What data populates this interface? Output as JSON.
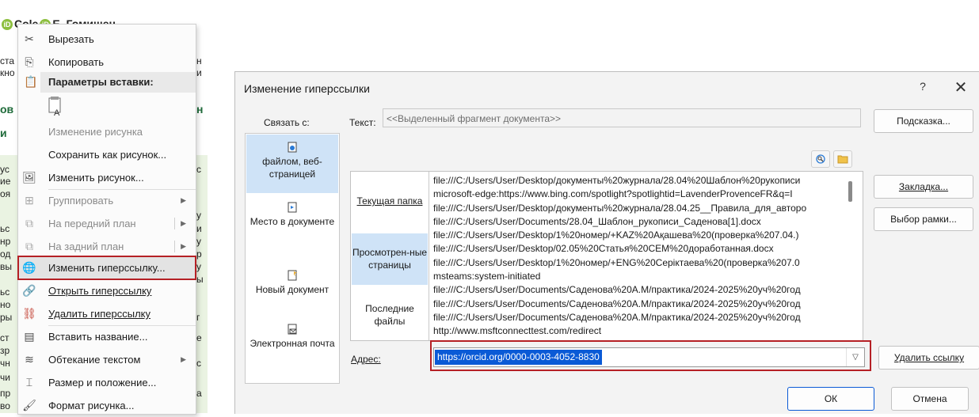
{
  "document": {
    "top_line": "Cole",
    "top_line_tail": "Е. Гомишен",
    "frags_left": [
      "ста",
      "кно",
      "ов",
      "и",
      "ус",
      "ие",
      "оя",
      "ьс",
      "нр",
      "од",
      "вы",
      "ьс",
      "но",
      "ры",
      "ст",
      "зр",
      "чн",
      "чи",
      "пр",
      "во"
    ],
    "frags_right": [
      "н",
      "и",
      "н",
      "и",
      "с",
      "у",
      "и",
      "у",
      "р",
      "у",
      "ы",
      "г",
      "е",
      "с",
      "а"
    ]
  },
  "context_menu": {
    "cut": "Вырезать",
    "copy": "Копировать",
    "paste_options": "Параметры вставки:",
    "change_picture_disabled": "Изменение рисунка",
    "save_as_picture": "Сохранить как рисунок...",
    "change_picture": "Изменить рисунок...",
    "group": "Группировать",
    "bring_forward": "На передний план",
    "send_backward": "На задний план",
    "edit_hyperlink": "Изменить гиперссылку...",
    "open_hyperlink": "Открыть гиперссылку",
    "remove_hyperlink": "Удалить гиперссылку",
    "insert_caption": "Вставить название...",
    "wrap_text": "Обтекание текстом",
    "size_position": "Размер и положение...",
    "format_picture": "Формат рисунка..."
  },
  "dialog": {
    "title": "Изменение гиперссылки",
    "help": "?",
    "close": "✕",
    "link_to_label": "Связать с:",
    "text_label": "Текст:",
    "text_value": "<<Выделенный фрагмент документа>>",
    "screentip_button": "Подсказка...",
    "link_types": {
      "file_web": "файлом, веб-страницей",
      "place_in_doc": "Место в документе",
      "new_doc": "Новый документ",
      "email": "Электронная почта"
    },
    "nav": {
      "current_folder": "Текущая папка",
      "browsed_pages": "Просмотрен-ные страницы",
      "recent_files": "Последние файлы"
    },
    "files": [
      "file:///C:/Users/User/Desktop/документы%20журнала/28.04%20Шаблон%20рукописи",
      "microsoft-edge:https://www.bing.com/spotlight?spotlightid=LavenderProvenceFR&q=I",
      "file:///C:/Users/User/Desktop/документы%20журнала/28.04.25__Правила_для_авторо",
      "file:///C:/Users/User/Documents/28.04_Шаблон_рукописи_Саденова[1].docx",
      "file:///C:/Users/User/Desktop/1%20номер/+KAZ%20Ақашева%20(проверка%207.04.)",
      "file:///C:/Users/User/Desktop/02.05%20Статья%20СЕМ%20доработанная.docx",
      "file:///C:/Users/User/Desktop/1%20номер/+ENG%20Серіктаева%20(проверка%207.0",
      "msteams:system-initiated",
      "file:///C:/Users/User/Documents/Саденова%20А.М/практика/2024-2025%20уч%20год",
      "file:///C:/Users/User/Documents/Саденова%20А.М/практика/2024-2025%20уч%20год",
      "file:///C:/Users/User/Documents/Саденова%20А.М/практика/2024-2025%20уч%20год",
      "http://www.msftconnecttest.com/redirect"
    ],
    "bookmark_button": "Закладка...",
    "target_frame_button": "Выбор рамки...",
    "address_label": "Адрес:",
    "address_value": "https://orcid.org/0000-0003-4052-8830",
    "remove_link_button": "Удалить ссылку",
    "ok_button": "ОК",
    "cancel_button": "Отмена"
  },
  "colors": {
    "highlight_outline": "#b52025",
    "selection_blue": "#0a5ad6",
    "nav_selected": "#cfe3f7"
  }
}
